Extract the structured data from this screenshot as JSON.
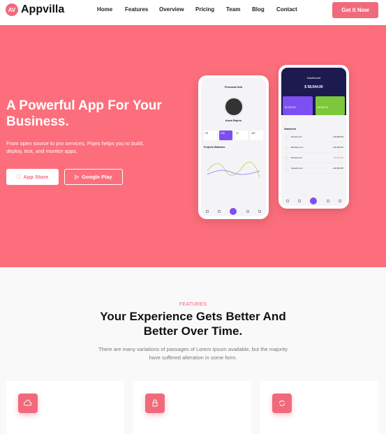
{
  "brand": {
    "name": "Appvilla",
    "mark": "AV"
  },
  "nav": [
    "Home",
    "Features",
    "Overview",
    "Pricing",
    "Team",
    "Blog",
    "Contact"
  ],
  "cta": "Get It Now",
  "hero": {
    "title": "A Powerful App For Your Business.",
    "subtitle": "From open source to pro services, Piqes helps you to build, deploy, test, and monitor apps.",
    "app_store": "App Store",
    "google_play": "Google Play"
  },
  "phone1": {
    "title": "Personal Info",
    "name": "Anna Rojers",
    "stats": [
      "29",
      "248",
      "21",
      "167"
    ],
    "section": "Projects Statistics"
  },
  "phone2": {
    "title": "Dashboard",
    "balance": "$ 58,544.00",
    "card1": "$2,300.00",
    "card2": "$6,320.00",
    "section": "Statement",
    "rows": [
      "Envato.com",
      "Booking.com",
      "Envato.com",
      "Upwork.com"
    ],
    "amounts": [
      "+ $3,800.00",
      "+ $2,600.00",
      "- $9,800.00",
      "+ $2,800.00"
    ]
  },
  "features": {
    "tag": "FEATURES",
    "heading": "Your Experience Gets Better And Better Over Time.",
    "text": "There are many variations of passages of Lorem Ipsum available, but the majority have suffered alteration in some form."
  }
}
